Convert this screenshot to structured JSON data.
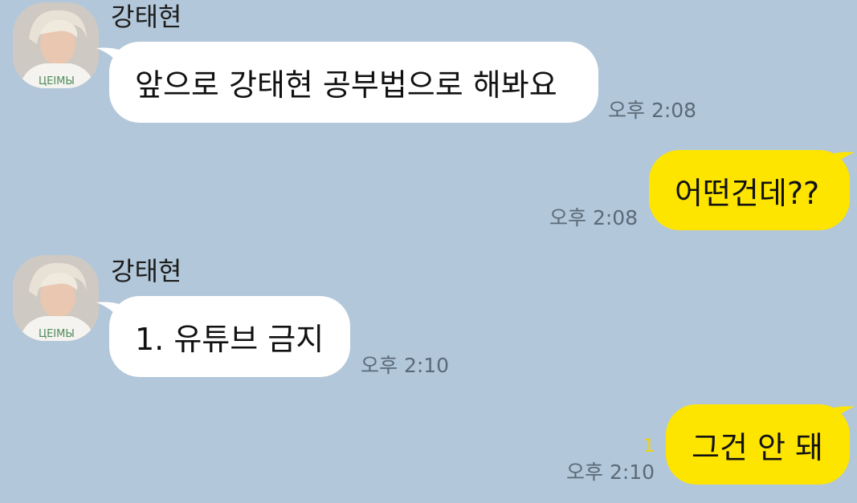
{
  "messages": [
    {
      "sender": "강태현",
      "text": "앞으로 강태현 공부법으로 해봐요",
      "time": "오후 2:08"
    },
    {
      "text": "어떤건데??",
      "time": "오후 2:08"
    },
    {
      "sender": "강태현",
      "text": "1. 유튜브 금지",
      "time": "오후 2:10"
    },
    {
      "text": "그건 안 돼",
      "time": "오후 2:10",
      "unread": "1"
    }
  ],
  "colors": {
    "background": "#b2c7da",
    "incoming_bubble": "#ffffff",
    "outgoing_bubble": "#fee500",
    "unread_count": "#f2d600"
  }
}
